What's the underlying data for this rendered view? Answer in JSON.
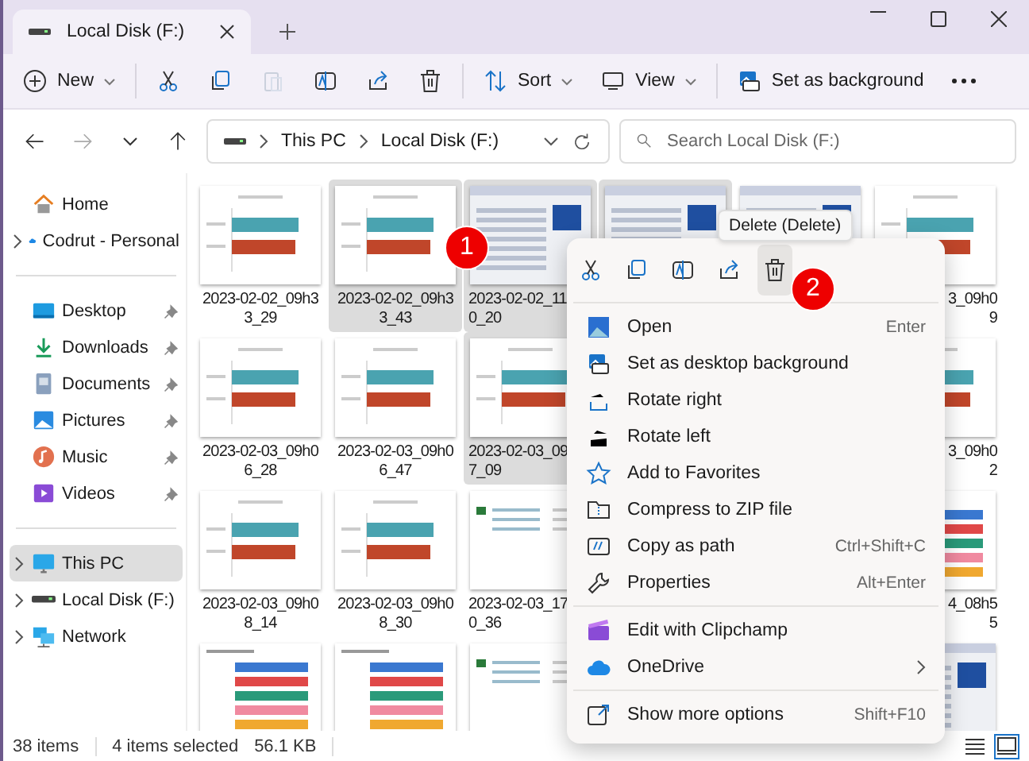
{
  "window": {
    "tab_title": "Local Disk (F:)"
  },
  "toolbar": [
    {
      "kind": "new",
      "label": "New",
      "disabled": false
    },
    {
      "kind": "cut",
      "disabled": false
    },
    {
      "kind": "copy",
      "disabled": false
    },
    {
      "kind": "paste",
      "disabled": true
    },
    {
      "kind": "rename",
      "disabled": false
    },
    {
      "kind": "share",
      "disabled": false
    },
    {
      "kind": "delete",
      "disabled": false
    },
    {
      "kind": "sort",
      "label": "Sort",
      "disabled": false
    },
    {
      "kind": "view",
      "label": "View",
      "disabled": false
    },
    {
      "kind": "background",
      "label": "Set as background",
      "disabled": false
    },
    {
      "kind": "more",
      "disabled": false
    }
  ],
  "address": {
    "segments": [
      "This PC",
      "Local Disk (F:)"
    ],
    "search_placeholder": "Search Local Disk (F:)"
  },
  "sidebar": [
    [
      {
        "kind": "home",
        "label": "Home",
        "expandable": false,
        "pinned": false,
        "selected": false
      },
      {
        "kind": "cloud",
        "label": "Codrut - Personal",
        "expandable": true,
        "pinned": false,
        "selected": false
      }
    ],
    [
      {
        "kind": "desktop",
        "label": "Desktop",
        "expandable": false,
        "pinned": true,
        "selected": false
      },
      {
        "kind": "downloads",
        "label": "Downloads",
        "expandable": false,
        "pinned": true,
        "selected": false
      },
      {
        "kind": "documents",
        "label": "Documents",
        "expandable": false,
        "pinned": true,
        "selected": false
      },
      {
        "kind": "pictures",
        "label": "Pictures",
        "expandable": false,
        "pinned": true,
        "selected": false
      },
      {
        "kind": "music",
        "label": "Music",
        "expandable": false,
        "pinned": true,
        "selected": false
      },
      {
        "kind": "videos",
        "label": "Videos",
        "expandable": false,
        "pinned": true,
        "selected": false
      }
    ],
    [
      {
        "kind": "pc",
        "label": "This PC",
        "expandable": true,
        "pinned": false,
        "selected": true
      },
      {
        "kind": "drive",
        "label": "Local Disk (F:)",
        "expandable": true,
        "pinned": false,
        "selected": false
      },
      {
        "kind": "network",
        "label": "Network",
        "expandable": true,
        "pinned": false,
        "selected": false
      }
    ]
  ],
  "file_rows": [
    {
      "left": [
        {
          "kind": "bars2",
          "selected": false,
          "label_lines": [
            "2023-02-02_09h3",
            "3_29"
          ]
        },
        {
          "kind": "bars2",
          "selected": true,
          "label_lines": [
            "2023-02-02_09h3",
            "3_43"
          ]
        },
        {
          "kind": "window",
          "selected": true,
          "label_lines": [
            "2023-02-02_11",
            "0_20"
          ]
        },
        {
          "kind": "window",
          "selected": true
        },
        {
          "kind": "window",
          "selected": false
        }
      ],
      "right": [
        {
          "kind": "bars2",
          "selected": false,
          "label_lines": [
            "3_09h0",
            "9"
          ]
        }
      ]
    },
    {
      "left": [
        {
          "kind": "bars2",
          "selected": false,
          "label_lines": [
            "2023-02-03_09h0",
            "6_28"
          ]
        },
        {
          "kind": "bars2",
          "selected": false,
          "label_lines": [
            "2023-02-03_09h0",
            "6_47"
          ]
        },
        {
          "kind": "bars2",
          "selected": true,
          "label_lines": [
            "2023-02-03_09",
            "7_09"
          ]
        }
      ],
      "right": [
        {
          "kind": "bars2",
          "selected": false,
          "label_lines": [
            "3_09h0",
            "2"
          ]
        }
      ]
    },
    {
      "left": [
        {
          "kind": "bars2",
          "selected": false,
          "label_lines": [
            "2023-02-03_09h0",
            "8_14"
          ]
        },
        {
          "kind": "bars2",
          "selected": false,
          "label_lines": [
            "2023-02-03_09h0",
            "8_30"
          ]
        },
        {
          "kind": "table",
          "selected": false,
          "label_lines": [
            "2023-02-03_17",
            "0_36"
          ]
        }
      ],
      "right": [
        {
          "kind": "bars5",
          "selected": false,
          "label_lines": [
            "4_08h5",
            "5"
          ]
        }
      ]
    },
    {
      "left": [
        {
          "kind": "bars5",
          "selected": false
        },
        {
          "kind": "bars5",
          "selected": false
        },
        {
          "kind": "table",
          "selected": false
        }
      ],
      "right": [
        {
          "kind": "window",
          "selected": false
        }
      ]
    }
  ],
  "context_menu": {
    "quick_actions": [
      {
        "kind": "cut",
        "selected": false
      },
      {
        "kind": "copy",
        "selected": false
      },
      {
        "kind": "rename",
        "selected": false
      },
      {
        "kind": "share",
        "selected": false
      },
      {
        "kind": "delete",
        "selected": true
      }
    ],
    "tooltip": "Delete (Delete)",
    "sections": [
      [
        {
          "kind": "open",
          "label": "Open",
          "shortcut": "Enter",
          "submenu": false
        },
        {
          "kind": "background",
          "label": "Set as desktop background",
          "submenu": false
        },
        {
          "kind": "rotate_right",
          "label": "Rotate right",
          "submenu": false
        },
        {
          "kind": "rotate_left",
          "label": "Rotate left",
          "submenu": false
        },
        {
          "kind": "favorite",
          "label": "Add to Favorites",
          "submenu": false
        },
        {
          "kind": "zip",
          "label": "Compress to ZIP file",
          "submenu": false
        },
        {
          "kind": "path",
          "label": "Copy as path",
          "shortcut": "Ctrl+Shift+C",
          "submenu": false
        },
        {
          "kind": "properties",
          "label": "Properties",
          "shortcut": "Alt+Enter",
          "submenu": false
        }
      ],
      [
        {
          "kind": "clipchamp",
          "label": "Edit with Clipchamp",
          "submenu": false
        },
        {
          "kind": "cloud",
          "label": "OneDrive",
          "submenu": true
        }
      ],
      [
        {
          "kind": "more",
          "label": "Show more options",
          "shortcut": "Shift+F10",
          "submenu": false
        }
      ]
    ]
  },
  "callouts": [
    "1",
    "2"
  ],
  "status_bar": {
    "count": "38 items",
    "selection": "4 items selected",
    "size": "56.1 KB"
  },
  "view_modes": [
    {
      "kind": "details",
      "selected": false
    },
    {
      "kind": "large_icons",
      "selected": true
    }
  ]
}
